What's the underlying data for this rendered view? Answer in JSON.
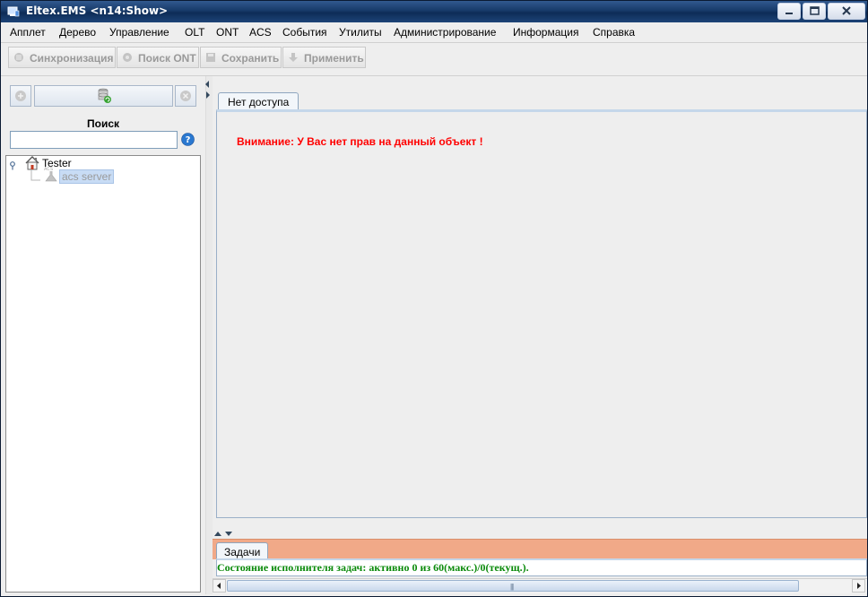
{
  "window": {
    "title": "Eltex.EMS <n14:Show>"
  },
  "menu": {
    "items": [
      "Апплет",
      "Дерево",
      "Управление",
      "OLT",
      "ONT",
      "ACS",
      "События",
      "Утилиты",
      "Администрирование",
      "Информация",
      "Справка"
    ]
  },
  "toolbar": {
    "sync": "Синхронизация",
    "search_ont": "Поиск ONT",
    "save": "Сохранить",
    "apply": "Применить"
  },
  "left": {
    "search_label": "Поиск",
    "search_value": "",
    "tree": {
      "root": "Tester",
      "child": "acs server",
      "child_icon_text": "ACS"
    }
  },
  "main": {
    "tab_label": "Нет доступа",
    "warning": "Внимание: У Вас нет прав на данный объект !"
  },
  "tasks": {
    "tab_label": "Задачи",
    "status": "Состояние исполнителя задач: активно 0 из 60(макс.)/0(текущ.)."
  },
  "colors": {
    "warning": "#ff0000",
    "status": "#0a8a0a",
    "tasks_strip": "#f1a988"
  }
}
